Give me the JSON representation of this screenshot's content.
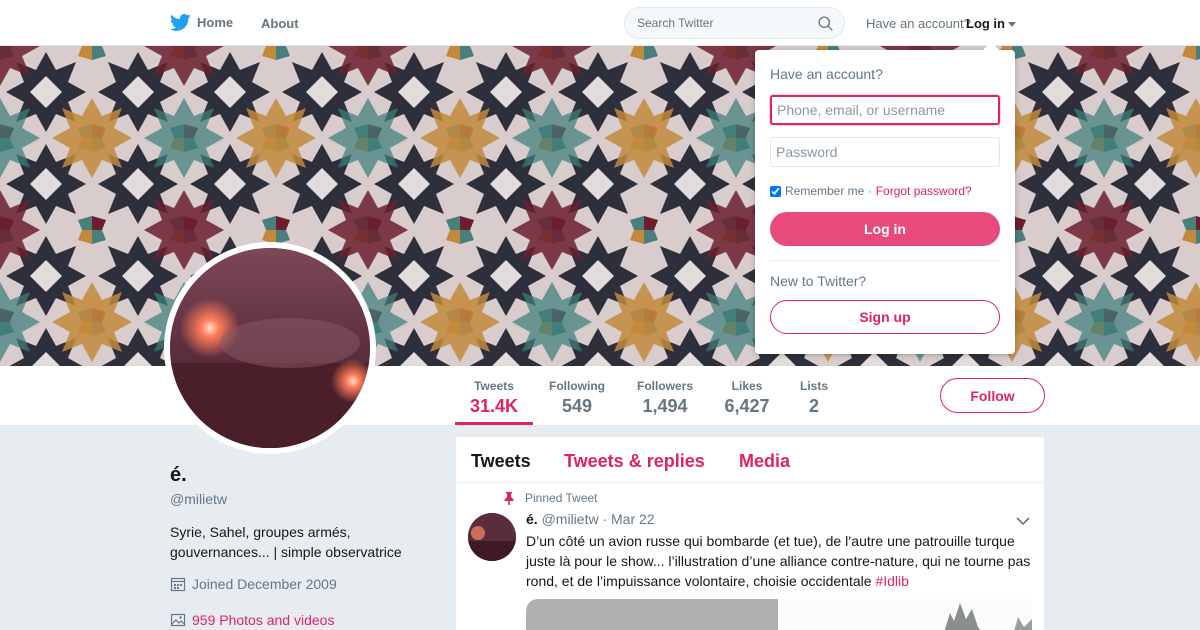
{
  "nav": {
    "home_label": "Home",
    "about_label": "About",
    "search_placeholder": "Search Twitter",
    "have_account": "Have an account?",
    "login_label": "Log in"
  },
  "profile": {
    "name": "é.",
    "handle": "@milietw",
    "bio": "Syrie, Sahel, groupes armés, gouvernances... | simple observatrice",
    "joined": "Joined December 2009",
    "photos": "959 Photos and videos"
  },
  "stats": [
    {
      "label": "Tweets",
      "value": "31.4K"
    },
    {
      "label": "Following",
      "value": "549"
    },
    {
      "label": "Followers",
      "value": "1,494"
    },
    {
      "label": "Likes",
      "value": "6,427"
    },
    {
      "label": "Lists",
      "value": "2"
    }
  ],
  "follow_label": "Follow",
  "timeline": {
    "tabs": [
      "Tweets",
      "Tweets & replies",
      "Media"
    ]
  },
  "tweet": {
    "pinned_label": "Pinned Tweet",
    "name": "é.",
    "handle": "@milietw",
    "date": "· Mar 22",
    "text": "D’un côté un avion russe qui bombarde (et tue), de l’autre une patrouille turque juste là pour le show... l’illustration d’une alliance contre-nature, qui ne tourne pas rond, et de l’impuissance volontaire, choisie occidentale ",
    "hashtag": "#Idlib"
  },
  "login_dropdown": {
    "title": "Have an account?",
    "username_placeholder": "Phone, email, or username",
    "password_placeholder": "Password",
    "remember_label": "Remember me ·",
    "forgot_label": "Forgot password?",
    "login_button": "Log in",
    "new_label": "New to Twitter?",
    "signup_button": "Sign up"
  },
  "colors": {
    "accent": "#e0245e",
    "text": "#14171a",
    "muted": "#657786",
    "background": "#e6ecf0"
  }
}
